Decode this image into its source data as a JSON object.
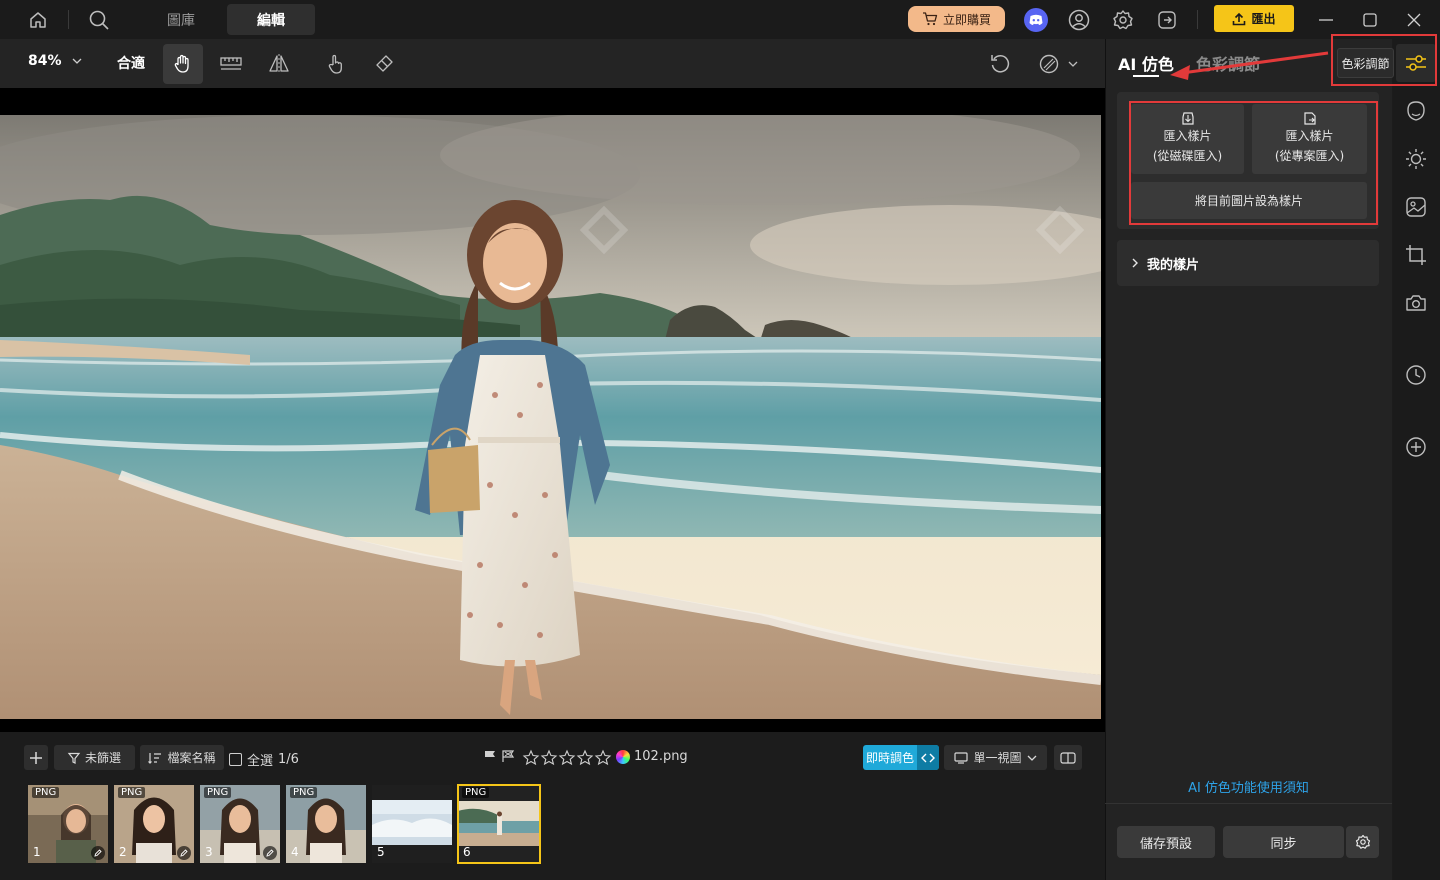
{
  "titlebar": {
    "tabs": [
      {
        "label": "圖庫",
        "active": false
      },
      {
        "label": "編輯",
        "active": true
      }
    ],
    "buy_label": "立即購買",
    "export_label": "匯出"
  },
  "toolbar": {
    "zoom": "84%",
    "fit": "合適"
  },
  "bottombar": {
    "filter_label": "未篩選",
    "sort_label": "檔案名稱",
    "select_all_label": "全選",
    "count": "1/6",
    "rating_stars": 0,
    "filename": "102.png",
    "realtime_label": "即時調色",
    "view_label": "單一視圖"
  },
  "filmstrip": [
    {
      "badge": "PNG",
      "num": "1",
      "edited": true,
      "selected": false
    },
    {
      "badge": "PNG",
      "num": "2",
      "edited": true,
      "selected": false
    },
    {
      "badge": "PNG",
      "num": "3",
      "edited": true,
      "selected": false
    },
    {
      "badge": "PNG",
      "num": "4",
      "edited": false,
      "selected": false
    },
    {
      "badge": "",
      "num": "5",
      "edited": false,
      "selected": false
    },
    {
      "badge": "PNG",
      "num": "6",
      "edited": false,
      "selected": true
    }
  ],
  "panel": {
    "tabs": [
      {
        "label": "AI 仿色",
        "active": true
      },
      {
        "label": "色彩調節",
        "active": false
      }
    ],
    "color_adjust_box": "色彩調節",
    "import_disk_line1": "匯入樣片",
    "import_disk_line2": "(從磁碟匯入)",
    "import_project_line1": "匯入樣片",
    "import_project_line2": "(從專案匯入)",
    "set_current_label": "將目前圖片設為樣片",
    "my_samples_label": "我的樣片",
    "help_link": "AI 仿色功能使用須知",
    "save_preset_label": "儲存預設",
    "sync_label": "同步"
  },
  "colors": {
    "accent_yellow": "#f5c518",
    "buy_orange": "#f3b98a",
    "link_blue": "#2ea3e8",
    "realtime_blue": "#1fa9d9",
    "annotation_red": "#e23a3a"
  }
}
